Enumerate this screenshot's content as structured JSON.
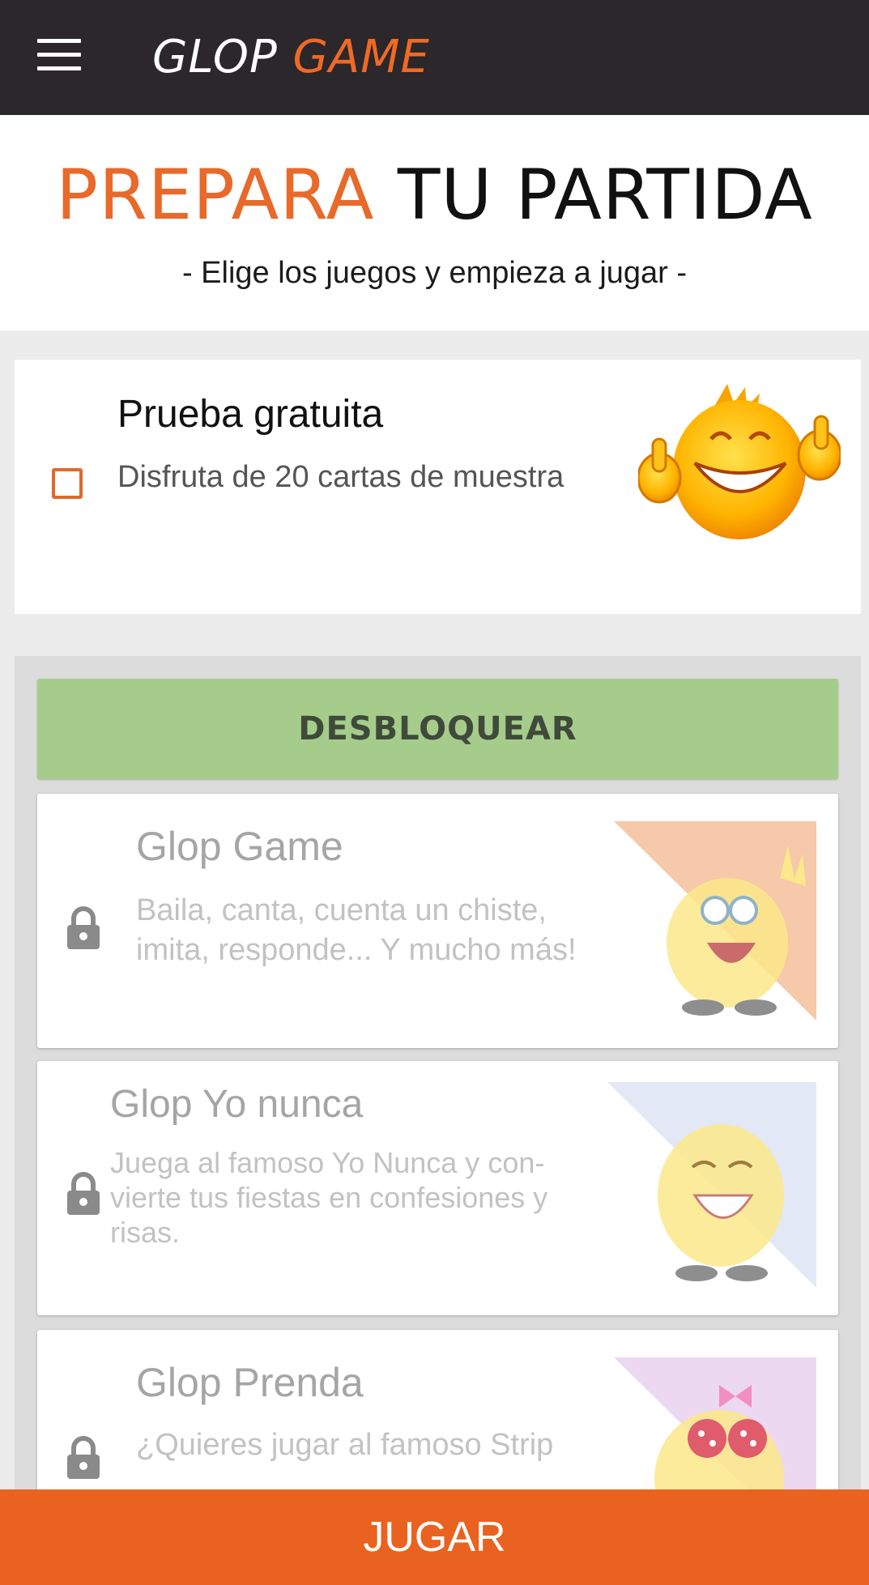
{
  "app": {
    "logo_part1": "GLOP",
    "logo_part2": "GAME",
    "menu_icon": "hamburger-menu-icon"
  },
  "header": {
    "title_accent": "PREPARA",
    "title_rest": "TU PARTIDA",
    "subtitle": "- Elige los juegos y empieza a jugar -"
  },
  "trial": {
    "title": "Prueba gratuita",
    "description": "Disfruta de 20 cartas de muestra",
    "checked": false,
    "icon": "thumbs-up-mascot-icon"
  },
  "unlock_label": "DESBLOQUEAR",
  "games": [
    {
      "title": "Glop Game",
      "description": "Baila, canta, cuenta un chiste, imita, responde... Y mucho más!",
      "locked": true,
      "accent": "#f5c9a9"
    },
    {
      "title": "Glop Yo nunca",
      "description": "Juega al famoso Yo Nunca y con­vierte tus fiestas en confesiones y risas.",
      "locked": true,
      "accent": "#e3e8f6"
    },
    {
      "title": "Glop Prenda",
      "description": "¿Quieres jugar al famoso Strip",
      "locked": true,
      "accent": "#ecd9f1"
    }
  ],
  "play_label": "JUGAR",
  "colors": {
    "brand_orange": "#ea621f",
    "topbar": "#2b272b",
    "unlock_green": "#a6cc8c"
  }
}
